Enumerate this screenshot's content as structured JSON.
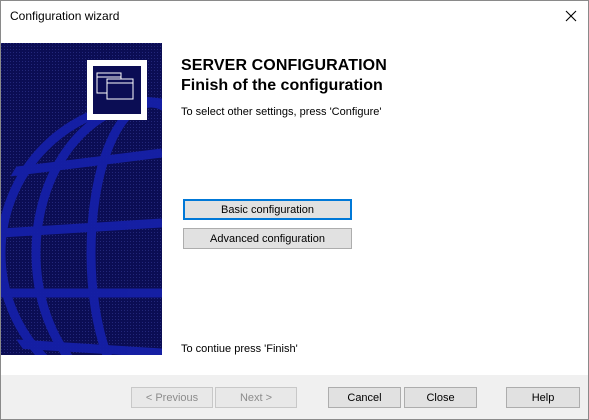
{
  "window": {
    "title": "Configuration wizard"
  },
  "header": {
    "title_line1": "SERVER CONFIGURATION",
    "title_line2": "Finish of the configuration",
    "instruction": "To select other settings, press 'Configure'"
  },
  "options": {
    "basic_label": "Basic configuration",
    "advanced_label": "Advanced configuration"
  },
  "footer": {
    "note": "To contiue press 'Finish'"
  },
  "buttons": {
    "previous": "< Previous",
    "next": "Next >",
    "cancel": "Cancel",
    "close": "Close",
    "help": "Help"
  },
  "icons": {
    "close": "close-icon",
    "banner": "globe-banner-image",
    "windows": "cascade-windows-icon"
  },
  "colors": {
    "banner_bg": "#0b0d54",
    "focus_border": "#0078d7",
    "button_bg": "#e1e1e1"
  }
}
